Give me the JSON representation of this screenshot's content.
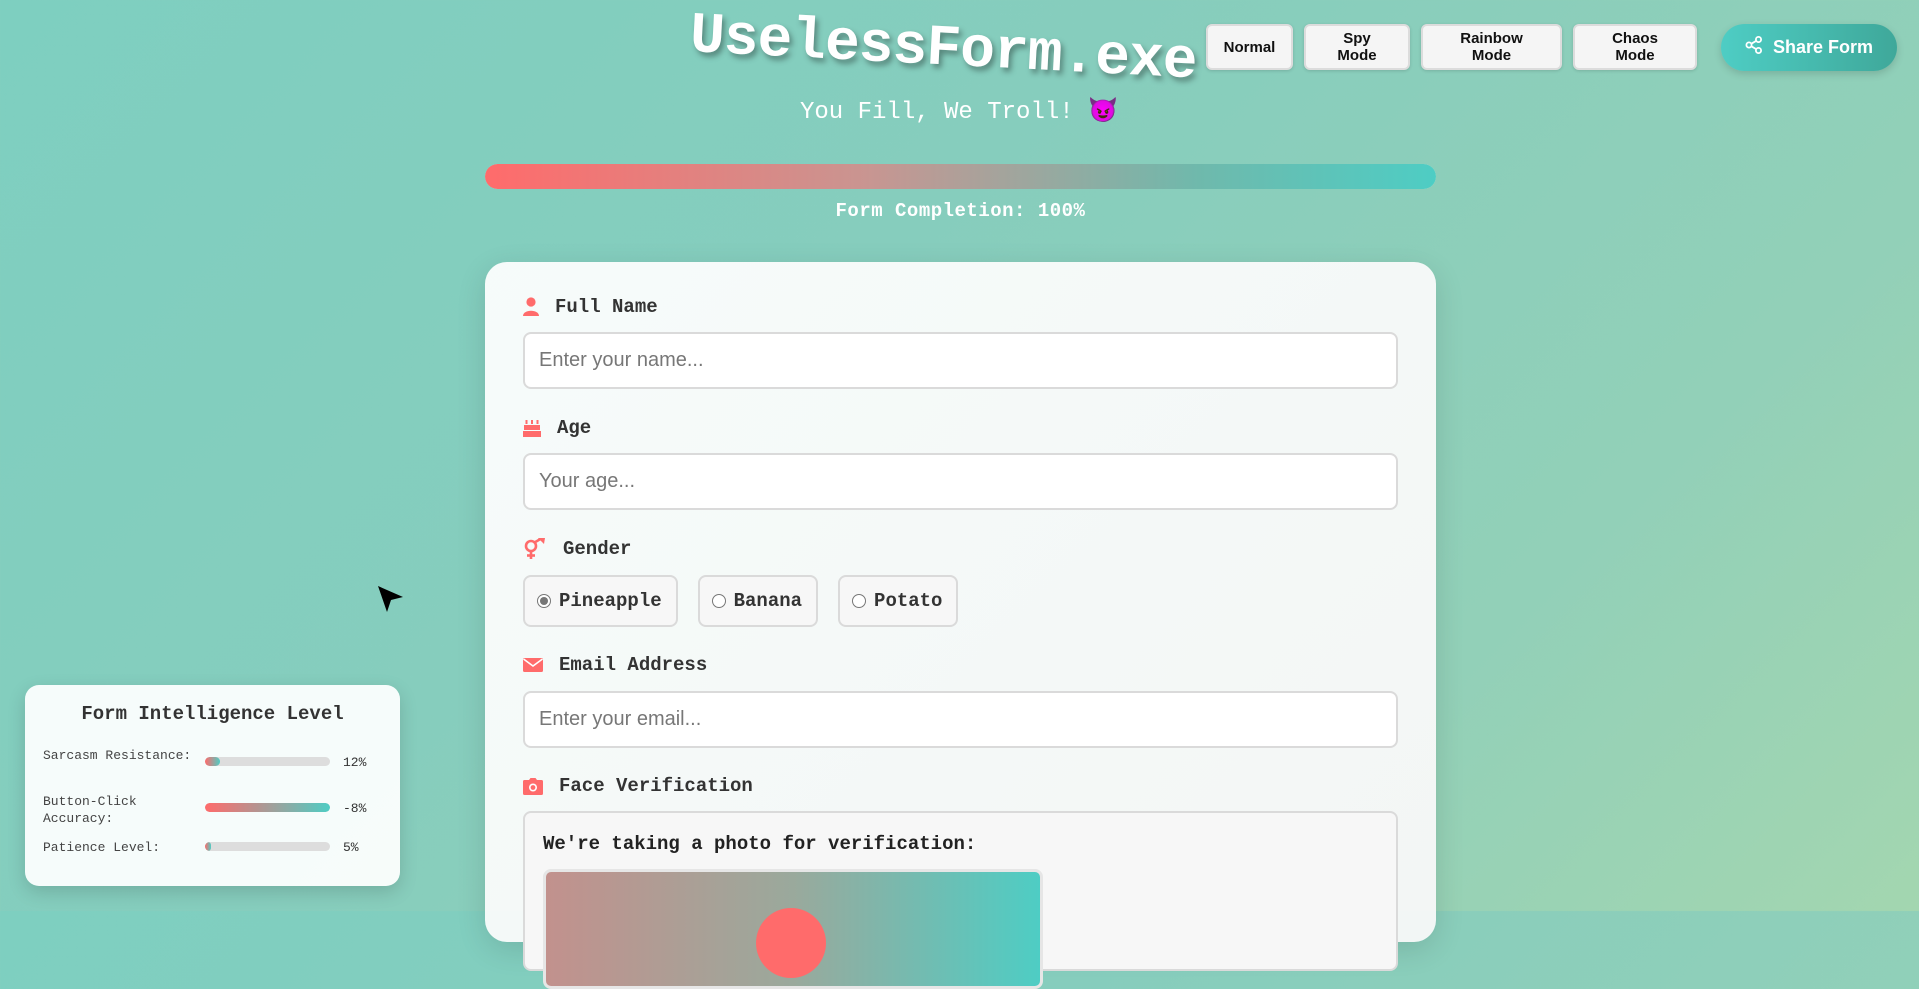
{
  "header": {
    "title": "UselessForm.exe",
    "subtitle": "You Fill, We Troll! 😈"
  },
  "modes": [
    {
      "label": "Normal"
    },
    {
      "label": "Spy Mode"
    },
    {
      "label": "Rainbow Mode"
    },
    {
      "label": "Chaos Mode"
    }
  ],
  "share": {
    "label": "Share Form",
    "icon": "share-icon"
  },
  "progress": {
    "label": "Form Completion: 100%",
    "value": 100
  },
  "form": {
    "full_name": {
      "label": "Full Name",
      "placeholder": "Enter your name...",
      "icon": "user-icon"
    },
    "age": {
      "label": "Age",
      "placeholder": "Your age...",
      "icon": "birthday-cake-icon"
    },
    "gender": {
      "label": "Gender",
      "icon": "gender-icon",
      "options": [
        "Pineapple",
        "Banana",
        "Potato"
      ],
      "selected": "Pineapple"
    },
    "email": {
      "label": "Email Address",
      "placeholder": "Enter your email...",
      "icon": "envelope-icon"
    },
    "face": {
      "label": "Face Verification",
      "icon": "camera-icon",
      "text": "We're taking a photo for verification:"
    }
  },
  "intelligence": {
    "title": "Form Intelligence Level",
    "metrics": [
      {
        "name": "Sarcasm Resistance:",
        "value_text": "12%",
        "fill": 0.12
      },
      {
        "name": "Button-Click Accuracy:",
        "value_text": "-8%",
        "fill": 1.0
      },
      {
        "name": "Patience Level:",
        "value_text": "5%",
        "fill": 0.05
      }
    ]
  },
  "colors": {
    "accent_red": "#ff6b6b",
    "accent_teal": "#4ecdc4",
    "background": "#86cdbd"
  }
}
